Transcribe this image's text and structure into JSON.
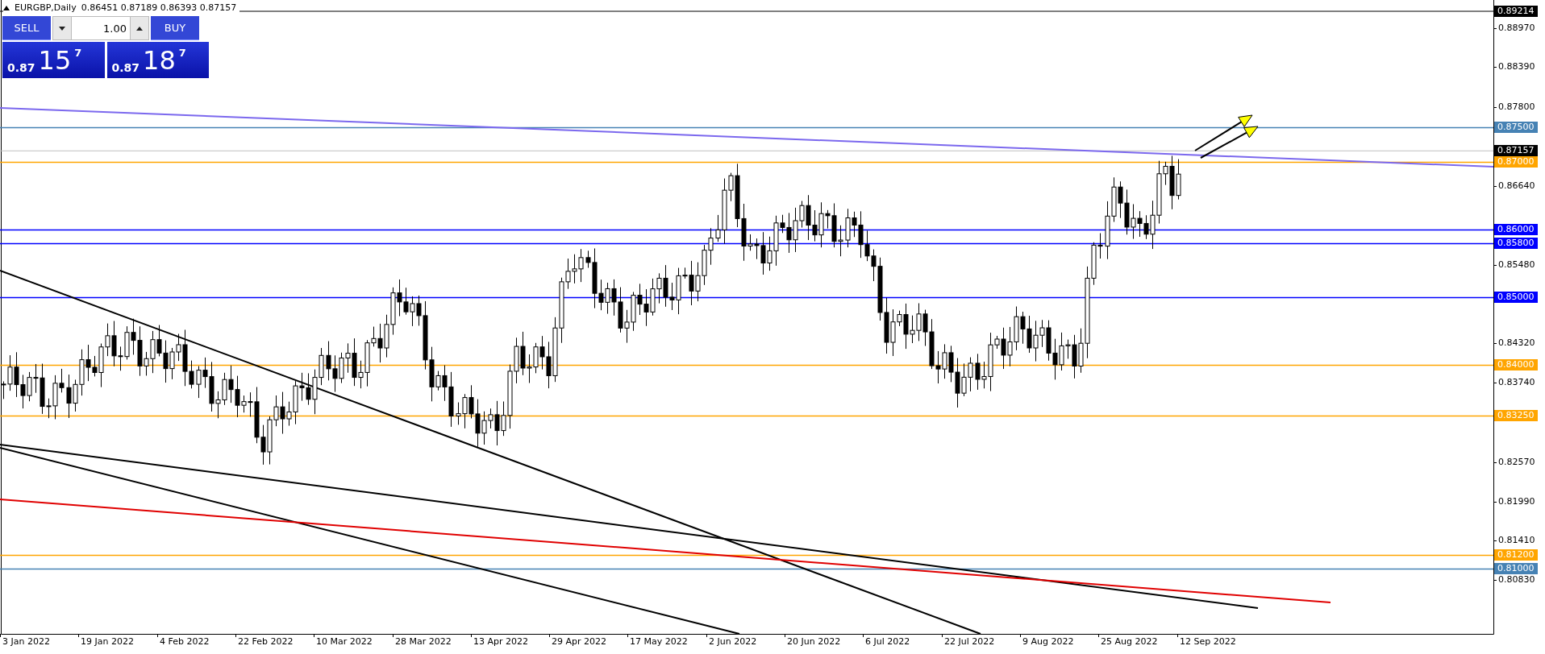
{
  "chart": {
    "symbol": "EURGBP,Daily",
    "ohlc": "0.86451 0.87189 0.86393 0.87157"
  },
  "trade_panel": {
    "sell_label": "SELL",
    "buy_label": "BUY",
    "volume": "1.00",
    "sell_price": {
      "prefix": "0.87",
      "big": "15",
      "pip": "7"
    },
    "buy_price": {
      "prefix": "0.87",
      "big": "18",
      "pip": "7"
    }
  },
  "price_axis": {
    "ticks": [
      "0.88970",
      "0.88390",
      "0.87800",
      "0.86640",
      "0.85480",
      "0.84320",
      "0.83740",
      "0.82570",
      "0.81990",
      "0.81410",
      "0.80830"
    ],
    "markers": [
      {
        "label": "0.89214",
        "kind": "high"
      },
      {
        "label": "0.87157",
        "kind": "current"
      }
    ]
  },
  "levels": [
    {
      "label": "0.87500",
      "color": "#4682b4"
    },
    {
      "label": "0.87000",
      "color": "#ffa500"
    },
    {
      "label": "0.86000",
      "color": "#0000ff"
    },
    {
      "label": "0.85800",
      "color": "#0000ff"
    },
    {
      "label": "0.85000",
      "color": "#0000ff"
    },
    {
      "label": "0.84000",
      "color": "#ffa500"
    },
    {
      "label": "0.83250",
      "color": "#ffa500"
    },
    {
      "label": "0.81200",
      "color": "#ffa500"
    },
    {
      "label": "0.81000",
      "color": "#4682b4"
    }
  ],
  "time_axis": {
    "labels": [
      "3 Jan 2022",
      "19 Jan 2022",
      "4 Feb 2022",
      "22 Feb 2022",
      "10 Mar 2022",
      "28 Mar 2022",
      "13 Apr 2022",
      "29 Apr 2022",
      "17 May 2022",
      "2 Jun 2022",
      "20 Jun 2022",
      "6 Jul 2022",
      "22 Jul 2022",
      "9 Aug 2022",
      "25 Aug 2022",
      "12 Sep 2022"
    ]
  }
}
